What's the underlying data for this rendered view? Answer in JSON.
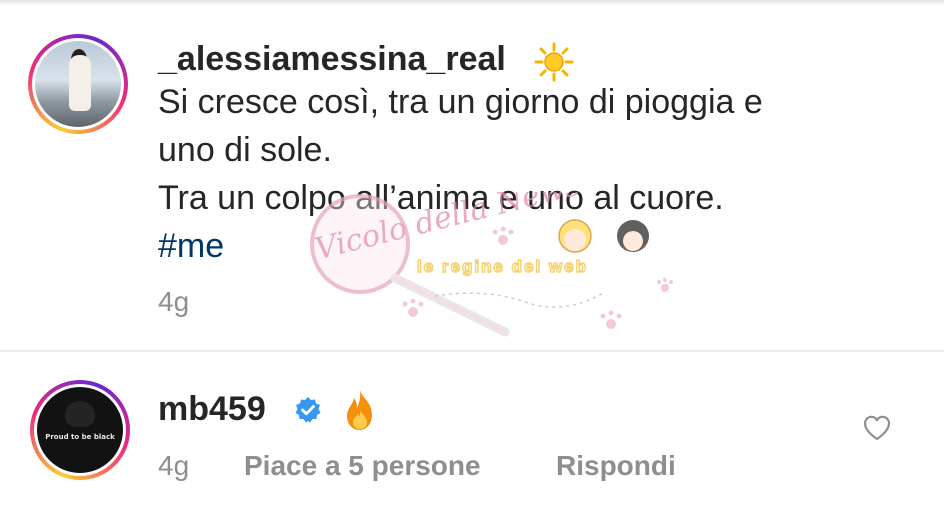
{
  "post": {
    "username": "_alessiamessina_real",
    "username_emoji": "sun-emoji",
    "caption_lines": [
      "Si cresce così, tra un giorno di pioggia e",
      "uno di sole.",
      "Tra un colpo all’anima e uno al cuore."
    ],
    "hashtag": "#me",
    "time": "4g"
  },
  "reply": {
    "username": "mb459",
    "verified": true,
    "emoji": "fire-emoji",
    "avatar_text": "Proud to be black",
    "time": "4g",
    "likes": "Piace a 5 persone",
    "reply_label": "Rispondi"
  },
  "watermark": {
    "brand": "Vicolo della News",
    "tagline": "le regine del web"
  },
  "colors": {
    "text": "#262626",
    "secondary": "#8e8e8e",
    "hashtag": "#00376b",
    "verified": "#3897f0"
  }
}
